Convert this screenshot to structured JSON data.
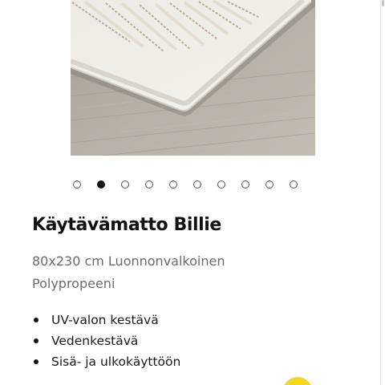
{
  "product": {
    "title": "Käytävämatto Billie",
    "subtitle": "80x230 cm Luonnonvalkoinen Polypropeeni"
  },
  "gallery": {
    "slide_count": 10,
    "active_index": 1
  },
  "features": [
    "UV-valon kestävä",
    "Vedenkestävä",
    "Sisä- ja ulkokäyttöön"
  ],
  "colors": {
    "accent": "#f7d71e",
    "dot_active": "#111111",
    "text_primary": "#111111",
    "text_secondary": "#6b6b6b"
  }
}
